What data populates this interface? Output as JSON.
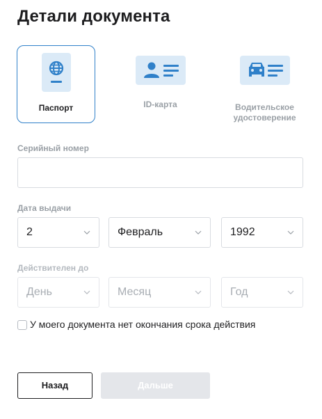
{
  "page": {
    "title": "Детали документа"
  },
  "doc_types": {
    "selected": "passport",
    "items": [
      {
        "id": "passport",
        "label": "Паспорт",
        "icon": "globe-passport-icon"
      },
      {
        "id": "id_card",
        "label": "ID-карта",
        "icon": "id-card-icon"
      },
      {
        "id": "license",
        "label": "Водительское удостоверение",
        "icon": "car-icon"
      }
    ]
  },
  "serial": {
    "label": "Серийный номер",
    "value": "",
    "placeholder": ""
  },
  "issue_date": {
    "label": "Дата выдачи",
    "day": "2",
    "month": "Февраль",
    "year": "1992"
  },
  "expiry_date": {
    "label": "Действителен до",
    "day_placeholder": "День",
    "month_placeholder": "Месяц",
    "year_placeholder": "Год"
  },
  "no_expiry": {
    "label": "У моего документа нет окончания срока действия",
    "checked": false
  },
  "buttons": {
    "back": "Назад",
    "next": "Дальше"
  },
  "colors": {
    "accent": "#2f80c9",
    "icon_bg": "#dbeaf7",
    "icon_fg": "#2f80c9",
    "disabled_bg": "#e4e6ea"
  }
}
